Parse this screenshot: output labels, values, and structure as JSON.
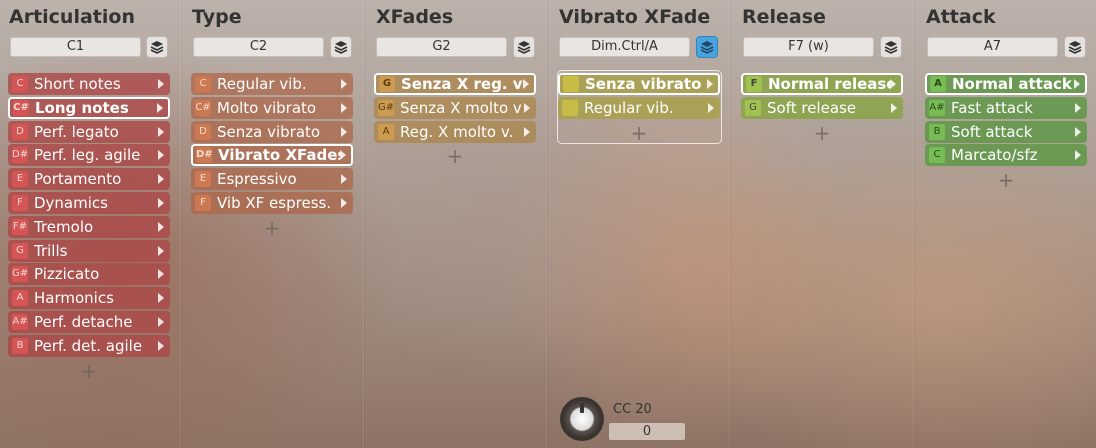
{
  "columns": [
    {
      "title": "Articulation",
      "key": "C1",
      "items": [
        {
          "key": "C",
          "label": "Short notes"
        },
        {
          "key": "C#",
          "label": "Long notes"
        },
        {
          "key": "D",
          "label": "Perf. legato"
        },
        {
          "key": "D#",
          "label": "Perf. leg. agile"
        },
        {
          "key": "E",
          "label": "Portamento"
        },
        {
          "key": "F",
          "label": "Dynamics"
        },
        {
          "key": "F#",
          "label": "Tremolo"
        },
        {
          "key": "G",
          "label": "Trills"
        },
        {
          "key": "G#",
          "label": "Pizzicato"
        },
        {
          "key": "A",
          "label": "Harmonics"
        },
        {
          "key": "A#",
          "label": "Perf. detache"
        },
        {
          "key": "B",
          "label": "Perf. det. agile"
        }
      ],
      "plus": "+"
    },
    {
      "title": "Type",
      "key": "C2",
      "items": [
        {
          "key": "C",
          "label": "Regular vib."
        },
        {
          "key": "C#",
          "label": "Molto vibrato"
        },
        {
          "key": "D",
          "label": "Senza vibrato"
        },
        {
          "key": "D#",
          "label": "Vibrato XFades"
        },
        {
          "key": "E",
          "label": "Espressivo"
        },
        {
          "key": "F",
          "label": "Vib XF espress."
        }
      ],
      "plus": "+"
    },
    {
      "title": "XFades",
      "key": "G2",
      "items": [
        {
          "key": "G",
          "label": "Senza X reg. vib"
        },
        {
          "key": "G#",
          "label": "Senza X molto v"
        },
        {
          "key": "A",
          "label": "Reg. X molto v."
        }
      ],
      "plus": "+"
    },
    {
      "title": "Vibrato XFade",
      "key": "Dim.Ctrl/A",
      "items": [
        {
          "key": "",
          "label": "Senza vibrato"
        },
        {
          "key": "",
          "label": "Regular vib."
        }
      ],
      "plus": "+"
    },
    {
      "title": "Release",
      "key": "F7 (w)",
      "items": [
        {
          "key": "F",
          "label": "Normal release"
        },
        {
          "key": "G",
          "label": "Soft release"
        }
      ],
      "plus": "+"
    },
    {
      "title": "Attack",
      "key": "A7",
      "items": [
        {
          "key": "A",
          "label": "Normal attack"
        },
        {
          "key": "A#",
          "label": "Fast attack"
        },
        {
          "key": "B",
          "label": "Soft attack"
        },
        {
          "key": "C",
          "label": "Marcato/sfz"
        }
      ],
      "plus": "+"
    }
  ],
  "controller": {
    "label": "CC 20",
    "value": "0"
  },
  "icons": {
    "layer": "layers-icon",
    "arrow": "chevron-right-icon",
    "add": "plus-icon",
    "knob": "knob-icon"
  },
  "colors": {
    "active_button": "#4aa3dc",
    "articulation": "#ac4646",
    "type": "#ac6446",
    "xfades": "#ac8446",
    "vibrato_xfade": "#a8a046",
    "release": "#8aa546",
    "attack": "#5f9646"
  }
}
